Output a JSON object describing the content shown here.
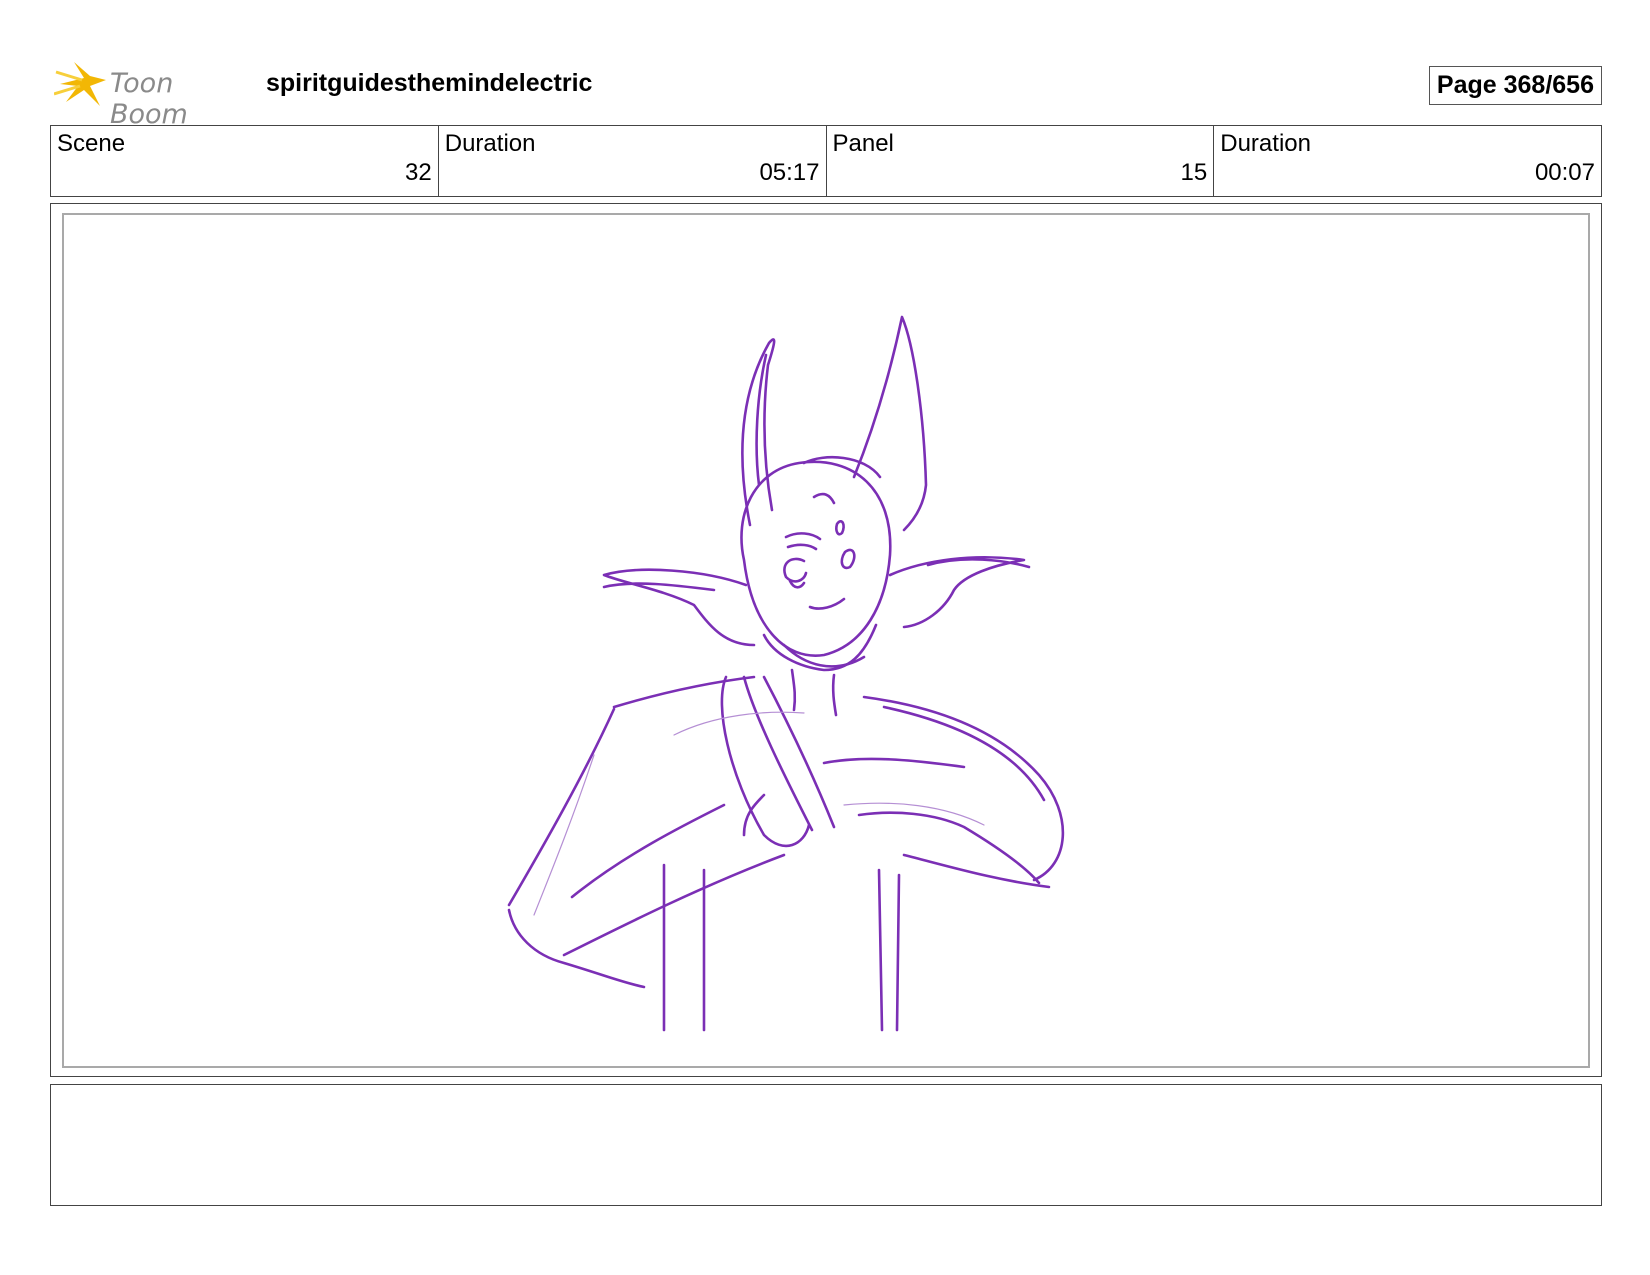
{
  "header": {
    "logo_text": "Toon Boom",
    "project_title": "spiritguidesthemindelectric",
    "page_label": "Page 368/656"
  },
  "info": {
    "scene_label": "Scene",
    "scene_value": "32",
    "scene_duration_label": "Duration",
    "scene_duration_value": "05:17",
    "panel_label": "Panel",
    "panel_value": "15",
    "panel_duration_label": "Duration",
    "panel_duration_value": "00:07"
  },
  "colors": {
    "sketch_line": "#7b2fb5",
    "logo_star": "#f2b705"
  },
  "icons": {
    "logo": "toon-boom-star-icon"
  },
  "notes": {
    "text": ""
  }
}
